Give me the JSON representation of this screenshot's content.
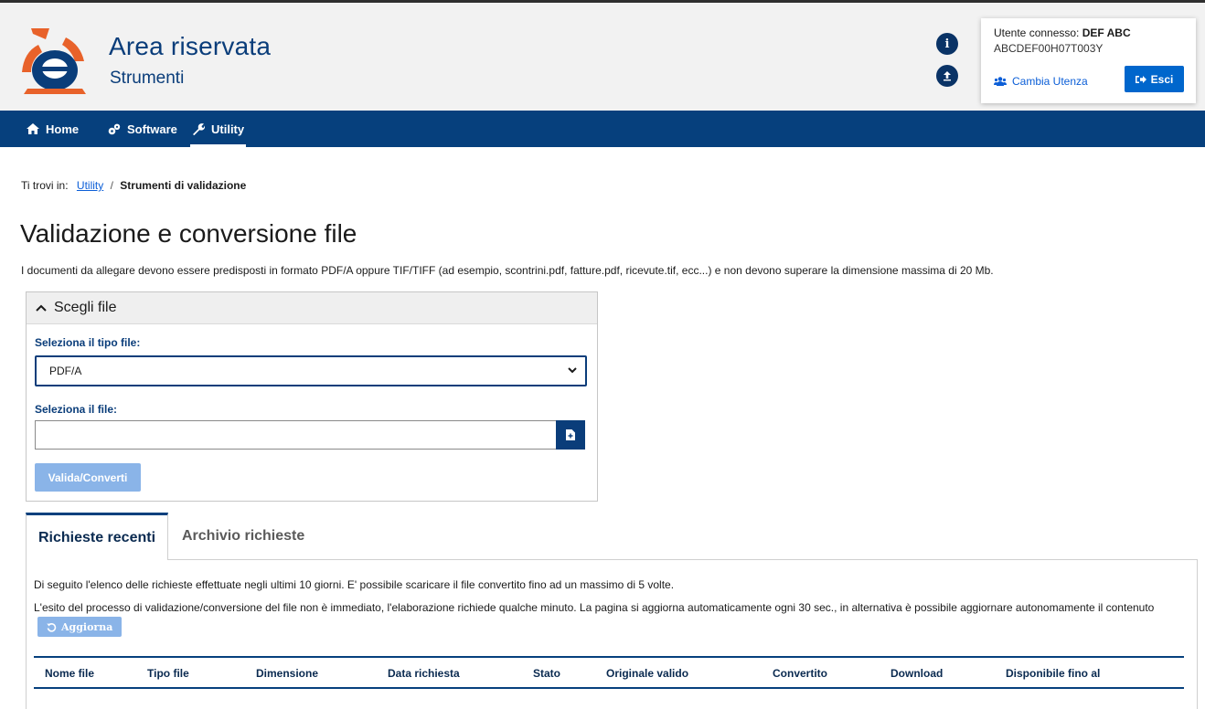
{
  "header": {
    "title": "Area riservata",
    "subtitle": "Strumenti",
    "info_icon": "info-circle-icon",
    "upload_icon": "upload-circle-icon"
  },
  "user": {
    "label": "Utente connesso:",
    "name": "DEF ABC",
    "code": "ABCDEF00H07T003Y",
    "switch_label": "Cambia Utenza",
    "logout_label": "Esci"
  },
  "nav": {
    "items": [
      {
        "label": "Home",
        "icon": "home-icon"
      },
      {
        "label": "Software",
        "icon": "software-icon"
      },
      {
        "label": "Utility",
        "icon": "wrench-icon"
      }
    ],
    "active": "Utility"
  },
  "breadcrumb": {
    "prefix": "Ti trovi in:",
    "link": "Utility",
    "separator": "/",
    "current": "Strumenti di validazione"
  },
  "page": {
    "title": "Validazione e conversione file",
    "intro": "I documenti da allegare devono essere predisposti in formato PDF/A oppure TIF/TIFF (ad esempio, scontrini.pdf, fatture.pdf, ricevute.tif, ecc...) e non devono superare la dimensione massima di 20 Mb."
  },
  "panel": {
    "heading": "Scegli file",
    "type_label": "Seleziona il tipo file:",
    "type_value": "PDF/A",
    "file_label": "Seleziona il file:",
    "file_value": "",
    "submit_label": "Valida/Converti"
  },
  "tabs": {
    "recent": "Richieste recenti",
    "archive": "Archivio richieste"
  },
  "recent": {
    "text1": "Di seguito l'elenco delle richieste effettuate negli ultimi 10 giorni. E' possibile scaricare il file convertito fino ad un massimo di 5 volte.",
    "text2": "L'esito del processo di validazione/conversione del file non è immediato, l'elaborazione richiede qualche minuto. La pagina si aggiorna automaticamente ogni 30 sec., in alternativa è possibile aggiornare autonomamente il contenuto",
    "refresh_label": "Aggiorna",
    "columns": [
      "Nome file",
      "Tipo file",
      "Dimensione",
      "Data richiesta",
      "Stato",
      "Originale valido",
      "Convertito",
      "Download",
      "Disponibile fino al"
    ]
  },
  "colors": {
    "primary": "#06407d",
    "accent_blue": "#0066cc",
    "disabled_button": "#8ab4e8",
    "logo_orange": "#e8622a"
  }
}
